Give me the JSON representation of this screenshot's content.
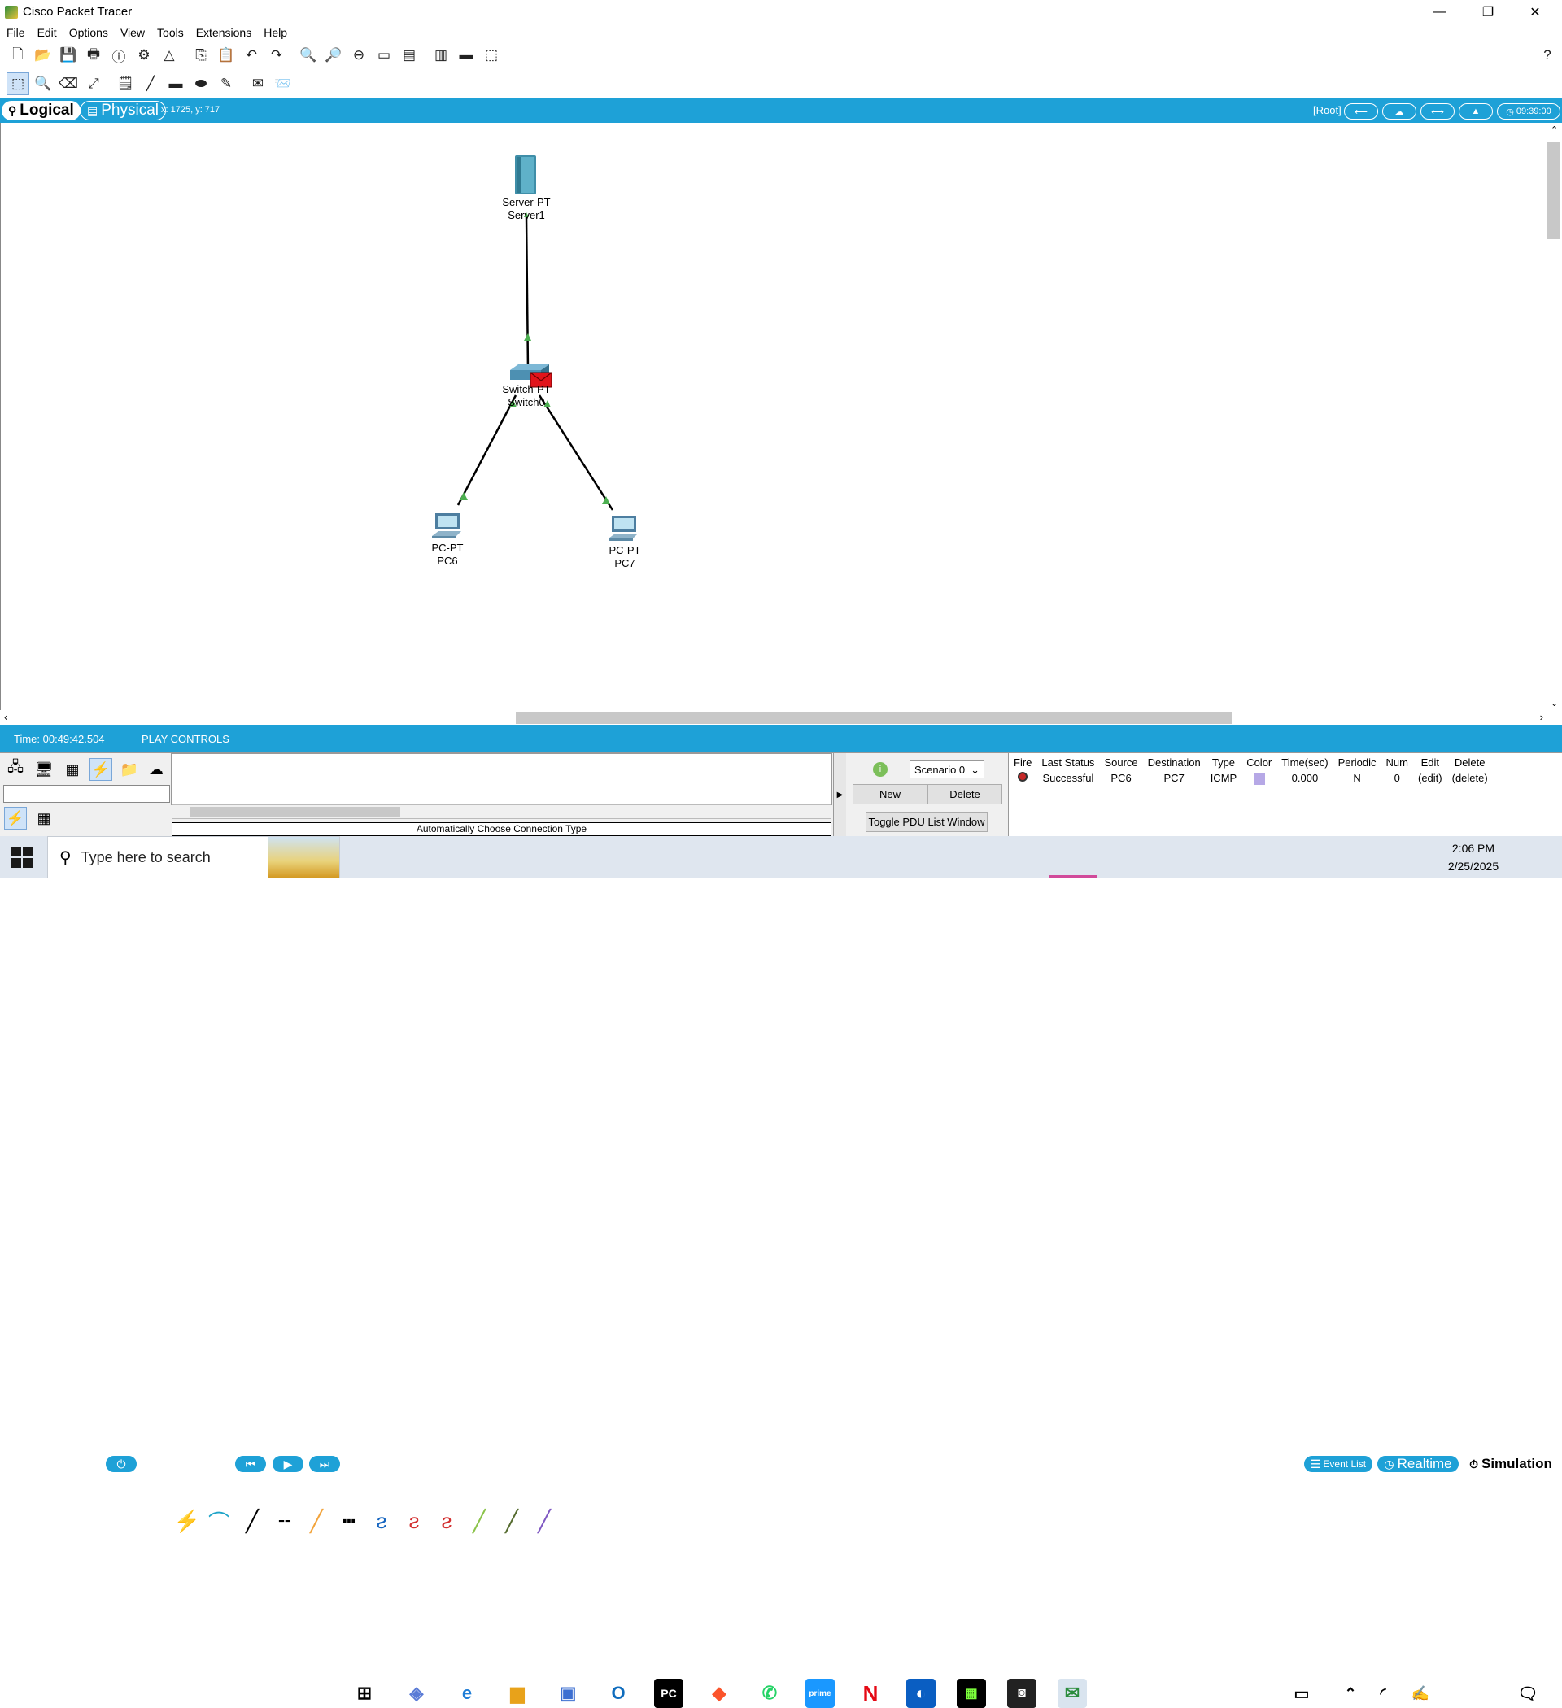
{
  "window": {
    "title": "Cisco Packet Tracer",
    "minimize": "—",
    "restore": "❐",
    "close": "✕"
  },
  "menu": [
    "File",
    "Edit",
    "Options",
    "View",
    "Tools",
    "Extensions",
    "Help"
  ],
  "help_icon": "?",
  "modebar": {
    "logical": "Logical",
    "physical": "Physical",
    "coords": "x: 1725, y: 717",
    "root": "[Root]",
    "clock": "09:39:00"
  },
  "devices": {
    "server": {
      "type": "Server-PT",
      "name": "Server1"
    },
    "switch": {
      "type": "Switch-PT",
      "name": "Switch0"
    },
    "pc6": {
      "type": "PC-PT",
      "name": "PC6"
    },
    "pc7": {
      "type": "PC-PT",
      "name": "PC7"
    }
  },
  "simbar": {
    "time": "Time: 00:49:42.504",
    "play_controls": "PLAY CONTROLS",
    "event_list": "Event List",
    "realtime": "Realtime",
    "simulation": "Simulation"
  },
  "bottom": {
    "connection_label": "Automatically Choose Connection Type",
    "scenario": "Scenario 0",
    "new": "New",
    "delete": "Delete",
    "toggle": "Toggle PDU List Window"
  },
  "pdu_table": {
    "headers": [
      "Fire",
      "Last Status",
      "Source",
      "Destination",
      "Type",
      "Color",
      "Time(sec)",
      "Periodic",
      "Num",
      "Edit",
      "Delete"
    ],
    "rows": [
      {
        "status": "Successful",
        "source": "PC6",
        "destination": "PC7",
        "type": "ICMP",
        "color": "#b6a8e6",
        "time": "0.000",
        "periodic": "N",
        "num": "0",
        "edit": "(edit)",
        "delete": "(delete)"
      }
    ]
  },
  "taskbar": {
    "search_placeholder": "Type here to search",
    "time": "2:06 PM",
    "date": "2/25/2025"
  }
}
